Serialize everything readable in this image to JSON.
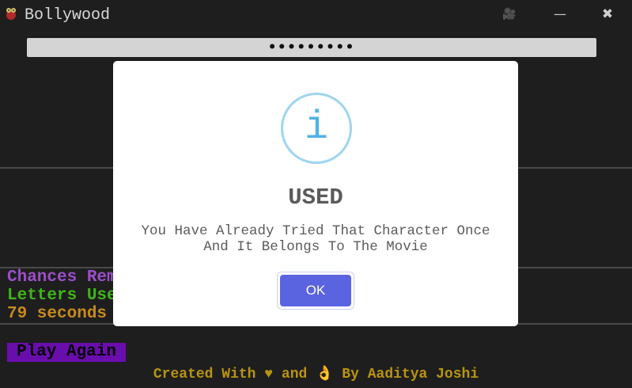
{
  "window": {
    "title": "Bollywood",
    "icon": "film-reel-icon",
    "controls": {
      "camera": "🎥",
      "minimize": "—",
      "close": "✖"
    }
  },
  "game": {
    "masked_word": "•••••••••",
    "chances_label": "Chances Rema",
    "letters_label": "Letters Usec",
    "timer": "79 seconds",
    "play_again": "Play Again",
    "credit": "Created With ♥ and 👌 By Aaditya Joshi"
  },
  "dialog": {
    "icon_glyph": "i",
    "title": "USED",
    "message_line1": "You Have Already Tried That Character Once",
    "message_line2": "And It Belongs To The Movie",
    "ok_label": "OK"
  },
  "colors": {
    "background": "#1e1e1e",
    "chances": "#9b4fc9",
    "letters": "#3fb51a",
    "timer": "#c88a1e",
    "play_again_bg": "#6a0dad",
    "credit": "#b8940f",
    "ok_button": "#5a63e0",
    "info_icon": "#4fb3e3"
  }
}
